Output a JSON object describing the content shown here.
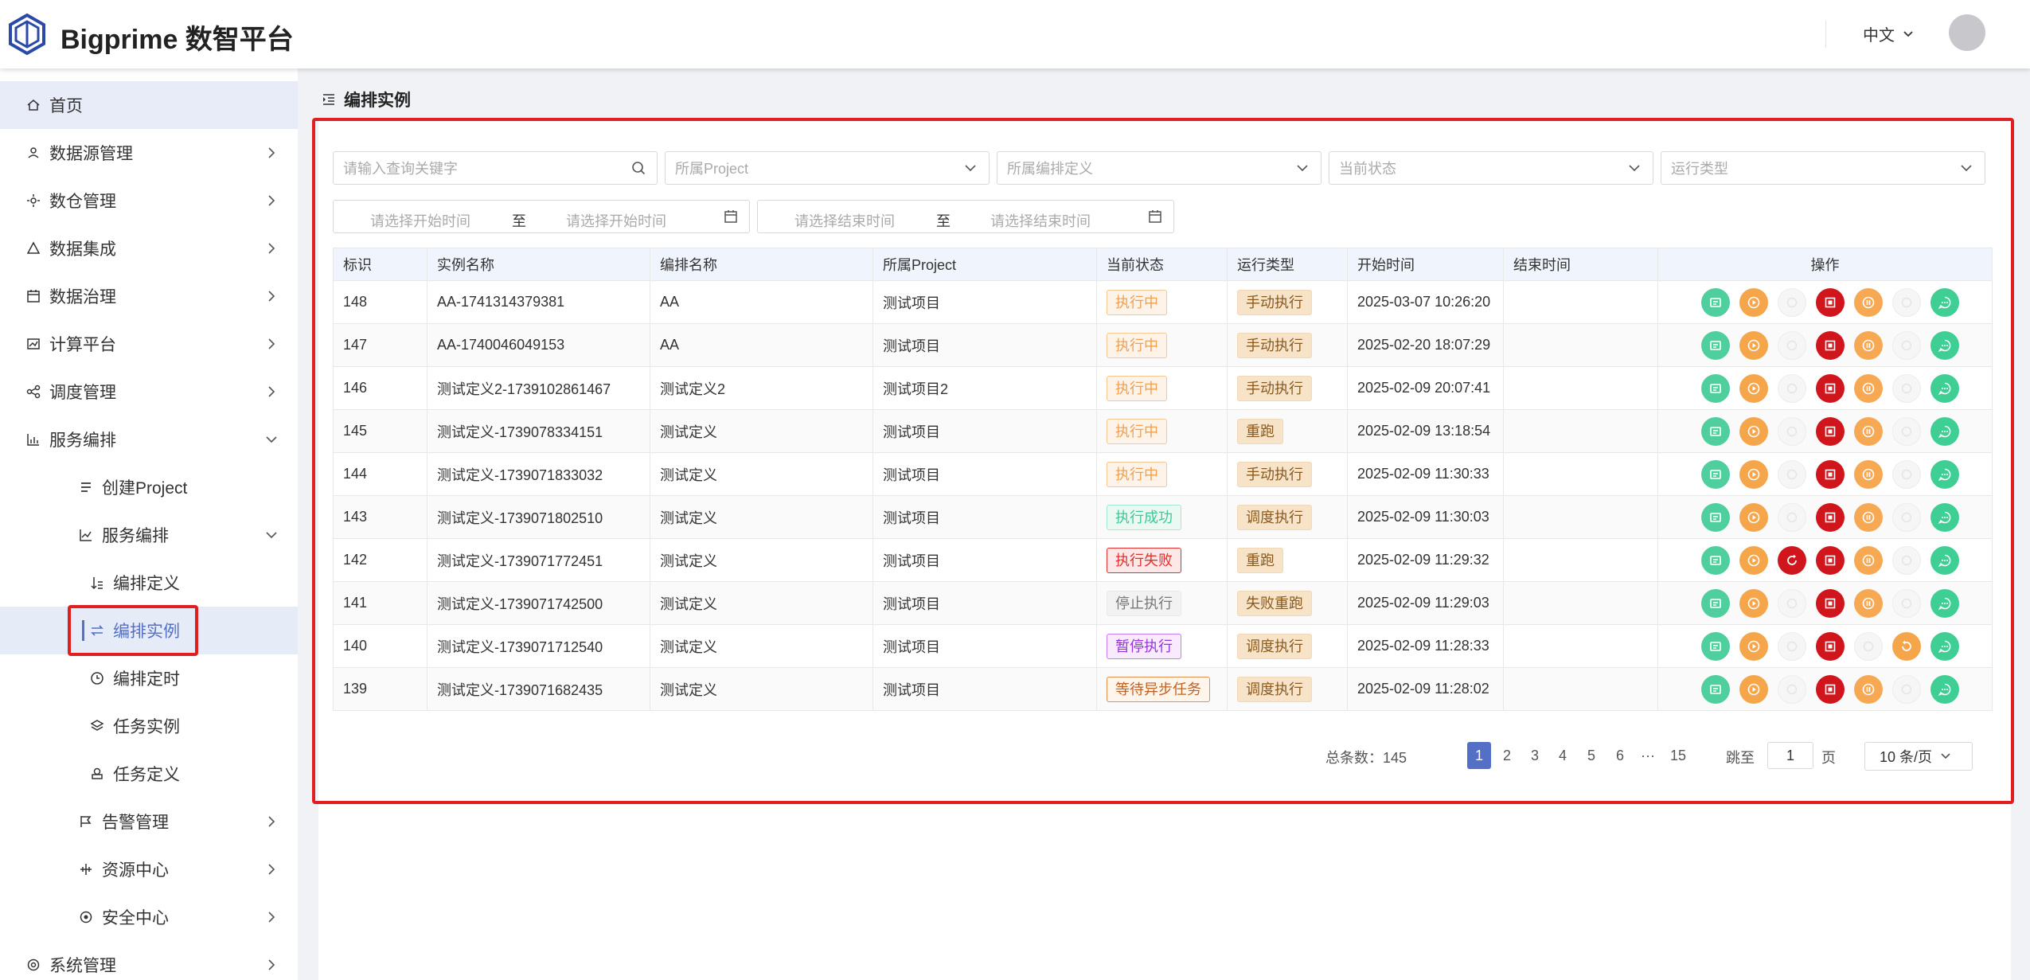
{
  "app": {
    "title": "Bigprime 数智平台",
    "language": "中文"
  },
  "sidebar": {
    "home": "首页",
    "items": [
      {
        "label": "数据源管理",
        "icon": "datasource-icon"
      },
      {
        "label": "数仓管理",
        "icon": "warehouse-icon"
      },
      {
        "label": "数据集成",
        "icon": "integration-icon"
      },
      {
        "label": "数据治理",
        "icon": "governance-icon"
      },
      {
        "label": "计算平台",
        "icon": "compute-icon"
      },
      {
        "label": "调度管理",
        "icon": "schedule-icon"
      },
      {
        "label": "服务编排",
        "icon": "chart-icon"
      }
    ],
    "sub": {
      "create_project": "创建Project",
      "orchestration": "服务编排",
      "definition": "编排定义",
      "instance": "编排实例",
      "timer": "编排定时",
      "task_instance": "任务实例",
      "task_definition": "任务定义",
      "alarm": "告警管理",
      "resource": "资源中心",
      "security": "安全中心"
    },
    "system": "系统管理"
  },
  "page": {
    "title": "编排实例"
  },
  "filters": {
    "keyword_placeholder": "请输入查询关键字",
    "project_placeholder": "所属Project",
    "definition_placeholder": "所属编排定义",
    "status_placeholder": "当前状态",
    "run_type_placeholder": "运行类型",
    "start_from": "请选择开始时间",
    "start_to": "请选择开始时间",
    "end_from": "请选择结束时间",
    "end_to": "请选择结束时间",
    "range_sep": "至"
  },
  "table": {
    "headers": [
      "标识",
      "实例名称",
      "编排名称",
      "所属Project",
      "当前状态",
      "运行类型",
      "开始时间",
      "结束时间",
      "操作"
    ],
    "rows": [
      {
        "id": "148",
        "name": "AA-1741314379381",
        "def": "AA",
        "project": "测试项目",
        "status": "执行中",
        "status_style": "orange",
        "type": "手动执行",
        "start": "2025-03-07 10:26:20",
        "end": "",
        "ops": [
          "teal",
          "orange",
          "disabled",
          "red",
          "lightorange",
          "disabled",
          "green"
        ]
      },
      {
        "id": "147",
        "name": "AA-1740046049153",
        "def": "AA",
        "project": "测试项目",
        "status": "执行中",
        "status_style": "orange",
        "type": "手动执行",
        "start": "2025-02-20 18:07:29",
        "end": "",
        "ops": [
          "teal",
          "orange",
          "disabled",
          "red",
          "lightorange",
          "disabled",
          "green"
        ]
      },
      {
        "id": "146",
        "name": "测试定义2-1739102861467",
        "def": "测试定义2",
        "project": "测试项目2",
        "status": "执行中",
        "status_style": "orange",
        "type": "手动执行",
        "start": "2025-02-09 20:07:41",
        "end": "",
        "ops": [
          "teal",
          "orange",
          "disabled",
          "red",
          "lightorange",
          "disabled",
          "green"
        ]
      },
      {
        "id": "145",
        "name": "测试定义-1739078334151",
        "def": "测试定义",
        "project": "测试项目",
        "status": "执行中",
        "status_style": "orange",
        "type": "重跑",
        "start": "2025-02-09 13:18:54",
        "end": "",
        "ops": [
          "teal",
          "orange",
          "disabled",
          "red",
          "lightorange",
          "disabled",
          "green"
        ]
      },
      {
        "id": "144",
        "name": "测试定义-1739071833032",
        "def": "测试定义",
        "project": "测试项目",
        "status": "执行中",
        "status_style": "orange",
        "type": "手动执行",
        "start": "2025-02-09 11:30:33",
        "end": "",
        "ops": [
          "teal",
          "orange",
          "disabled",
          "red",
          "lightorange",
          "disabled",
          "green"
        ]
      },
      {
        "id": "143",
        "name": "测试定义-1739071802510",
        "def": "测试定义",
        "project": "测试项目",
        "status": "执行成功",
        "status_style": "green",
        "type": "调度执行",
        "start": "2025-02-09 11:30:03",
        "end": "",
        "ops": [
          "teal",
          "orange",
          "disabled",
          "red",
          "lightorange",
          "disabled",
          "green"
        ]
      },
      {
        "id": "142",
        "name": "测试定义-1739071772451",
        "def": "测试定义",
        "project": "测试项目",
        "status": "执行失败",
        "status_style": "red",
        "type": "重跑",
        "start": "2025-02-09 11:29:32",
        "end": "",
        "ops": [
          "teal",
          "orange",
          "rerun",
          "red",
          "lightorange",
          "disabled",
          "green"
        ]
      },
      {
        "id": "141",
        "name": "测试定义-1739071742500",
        "def": "测试定义",
        "project": "测试项目",
        "status": "停止执行",
        "status_style": "gray",
        "type": "失败重跑",
        "start": "2025-02-09 11:29:03",
        "end": "",
        "ops": [
          "teal",
          "orange",
          "disabled",
          "red",
          "lightorange",
          "disabled",
          "green"
        ]
      },
      {
        "id": "140",
        "name": "测试定义-1739071712540",
        "def": "测试定义",
        "project": "测试项目",
        "status": "暂停执行",
        "status_style": "purple",
        "type": "调度执行",
        "start": "2025-02-09 11:28:33",
        "end": "",
        "ops": [
          "teal",
          "orange",
          "disabled",
          "red",
          "disabled",
          "resume",
          "green"
        ]
      },
      {
        "id": "139",
        "name": "测试定义-1739071682435",
        "def": "测试定义",
        "project": "测试项目",
        "status": "等待异步任务",
        "status_style": "brown",
        "type": "调度执行",
        "start": "2025-02-09 11:28:02",
        "end": "",
        "ops": [
          "teal",
          "orange",
          "disabled",
          "red",
          "lightorange",
          "disabled",
          "green"
        ]
      }
    ]
  },
  "pagination": {
    "total_label": "总条数：145",
    "pages": [
      "1",
      "2",
      "3",
      "4",
      "5",
      "6",
      "···",
      "15"
    ],
    "current": "1",
    "jump_label": "跳至",
    "jump_value": "1",
    "page_unit": "页",
    "page_size": "10 条/页"
  },
  "colors": {
    "accent": "#5470c6",
    "highlight": "#e02020"
  }
}
